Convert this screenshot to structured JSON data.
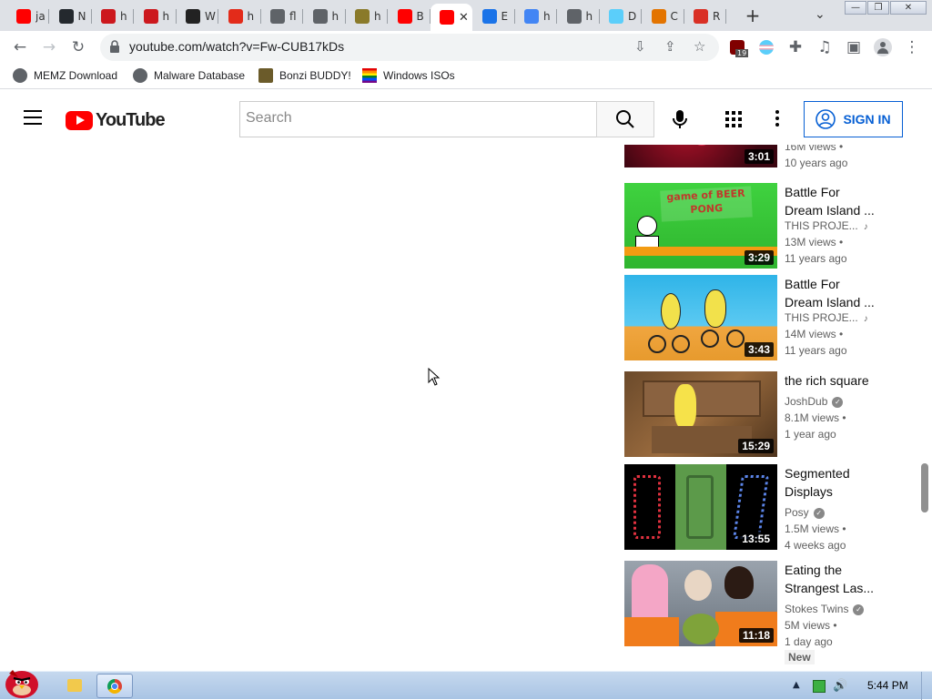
{
  "browser": {
    "tabs": [
      {
        "label": "ja",
        "fav": "youtube-icon",
        "color": "#ff0000"
      },
      {
        "label": "N",
        "fav": "github-icon",
        "color": "#24292e"
      },
      {
        "label": "h",
        "fav": "youtube-old-icon",
        "color": "#cc181e"
      },
      {
        "label": "h",
        "fav": "youtube-old-icon",
        "color": "#cc181e"
      },
      {
        "label": "W",
        "fav": "archive-icon",
        "color": "#222222"
      },
      {
        "label": "h",
        "fav": "adobe-icon",
        "color": "#e32b1a"
      },
      {
        "label": "fl",
        "fav": "globe-icon",
        "color": "#5f6368"
      },
      {
        "label": "h",
        "fav": "globe-icon",
        "color": "#5f6368"
      },
      {
        "label": "h",
        "fav": "pixel-icon",
        "color": "#8a7a2a"
      },
      {
        "label": "B",
        "fav": "youtube-icon",
        "color": "#ff0000"
      },
      {
        "label": "",
        "fav": "youtube-icon",
        "color": "#ff0000",
        "active": true
      },
      {
        "label": "E",
        "fav": "puzzle-icon",
        "color": "#1a73e8"
      },
      {
        "label": "h",
        "fav": "google-icon",
        "color": "#4285f4"
      },
      {
        "label": "h",
        "fav": "globe-icon",
        "color": "#5f6368"
      },
      {
        "label": "D",
        "fav": "flag-icon",
        "color": "#5bcefa"
      },
      {
        "label": "C",
        "fav": "chrome-store-icon",
        "color": "#e37400"
      },
      {
        "label": "R",
        "fav": "speech-bubble-icon",
        "color": "#d93025"
      }
    ],
    "tab_close": "✕",
    "new_tab": "+",
    "url": "youtube.com/watch?v=Fw-CUB17kDs",
    "extension_badge": "19",
    "bookmarks": [
      {
        "label": "MEMZ Download"
      },
      {
        "label": "Malware Database"
      },
      {
        "label": "Bonzi BUDDY!"
      },
      {
        "label": "Windows ISOs"
      }
    ]
  },
  "youtube": {
    "logo_text": "YouTube",
    "search_placeholder": "Search",
    "sign_in_label": "SIGN IN"
  },
  "recommendations": [
    {
      "title1": "",
      "title2": "",
      "channel": "",
      "views": "16M views",
      "age": "10 years ago",
      "duration": "3:01",
      "verified": false,
      "music": false
    },
    {
      "title1": "Battle For",
      "title2": "Dream Island ...",
      "channel": "THIS PROJE...",
      "views": "13M views",
      "age": "11 years ago",
      "duration": "3:29",
      "verified": false,
      "music": true,
      "thumb_text": "game of BEER PONG"
    },
    {
      "title1": "Battle For",
      "title2": "Dream Island ...",
      "channel": "THIS PROJE...",
      "views": "14M views",
      "age": "11 years ago",
      "duration": "3:43",
      "verified": false,
      "music": true
    },
    {
      "title1": "the rich square",
      "title2": "",
      "channel": "JoshDub",
      "views": "8.1M views",
      "age": "1 year ago",
      "duration": "15:29",
      "verified": true,
      "music": false
    },
    {
      "title1": "Segmented",
      "title2": "Displays",
      "channel": "Posy",
      "views": "1.5M views",
      "age": "4 weeks ago",
      "duration": "13:55",
      "verified": true,
      "music": false
    },
    {
      "title1": "Eating the",
      "title2": "Strangest Las...",
      "channel": "Stokes Twins",
      "views": "5M views",
      "age": "1 day ago",
      "duration": "11:18",
      "verified": true,
      "music": false,
      "badge": "New"
    }
  ],
  "taskbar": {
    "clock": "5:44 PM"
  },
  "colors": {
    "youtube_red": "#ff0000",
    "link_blue": "#065fd4",
    "tab_strip": "#dee1e6"
  }
}
